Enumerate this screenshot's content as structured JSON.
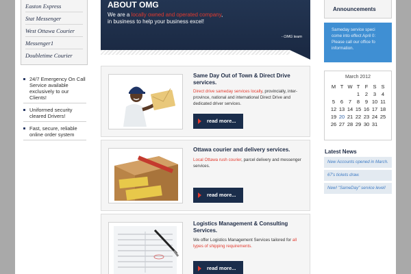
{
  "left": {
    "services": [
      "Easton Express",
      "Stat Messenger",
      "West Ottawa Courier",
      "Messenger1",
      "Doubletime Courier"
    ],
    "features": [
      "24/7 Emergency On Call Service available exclusively to our Clients!",
      "Uniformed security cleared Drivers!",
      "Fast, secure, reliable online order system"
    ]
  },
  "hero": {
    "title": "ABOUT OMG",
    "line1_pre": "We are a ",
    "line1_red": "locally owned and operated company",
    "line1_post": ",",
    "line2": "in business to help your business excel!",
    "signature": "- OMG team"
  },
  "cards": [
    {
      "title": "Same Day Out of Town & Direct Drive services.",
      "desc_red": "Direct drive sameday services locally",
      "desc_rest": ", provincially, inter-province, national and international Direct Drive and dedicated driver services.",
      "button": "read more..."
    },
    {
      "title": "Ottawa courier and delivery services.",
      "desc_red": "Local Ottawa rush courier",
      "desc_rest": ", parcel delivery and messenger services.",
      "button": "read more..."
    },
    {
      "title": "Logistics Management & Consulting Services.",
      "desc_pre": "We offer Logistics Management Services tailored for ",
      "desc_red": "all types of shipping requirements.",
      "button": "read more..."
    }
  ],
  "right": {
    "announcements_title": "Announcements",
    "announcement_text": "Sameday service speci come into effect April 0: Please call our office fo information.",
    "calendar": {
      "month": "March 2012",
      "days": [
        "M",
        "T",
        "W",
        "T",
        "F",
        "S",
        "S"
      ],
      "weeks": [
        [
          "",
          "",
          "",
          "1",
          "2",
          "3",
          "4"
        ],
        [
          "5",
          "6",
          "7",
          "8",
          "9",
          "10",
          "11"
        ],
        [
          "12",
          "13",
          "14",
          "15",
          "16",
          "17",
          "18"
        ],
        [
          "19",
          "20",
          "21",
          "22",
          "23",
          "24",
          "25"
        ],
        [
          "26",
          "27",
          "28",
          "29",
          "30",
          "31",
          ""
        ]
      ],
      "today": "20"
    },
    "news_title": "Latest News",
    "news": [
      "New Accounts opened in March.",
      "67's tickets draw.",
      "New! \"SameDay\" service level!"
    ]
  },
  "colors": {
    "navy": "#1a2d4b",
    "accent_red": "#e23a2e",
    "announcement_blue": "#3f8fd3",
    "news_link": "#3e7bc4"
  }
}
